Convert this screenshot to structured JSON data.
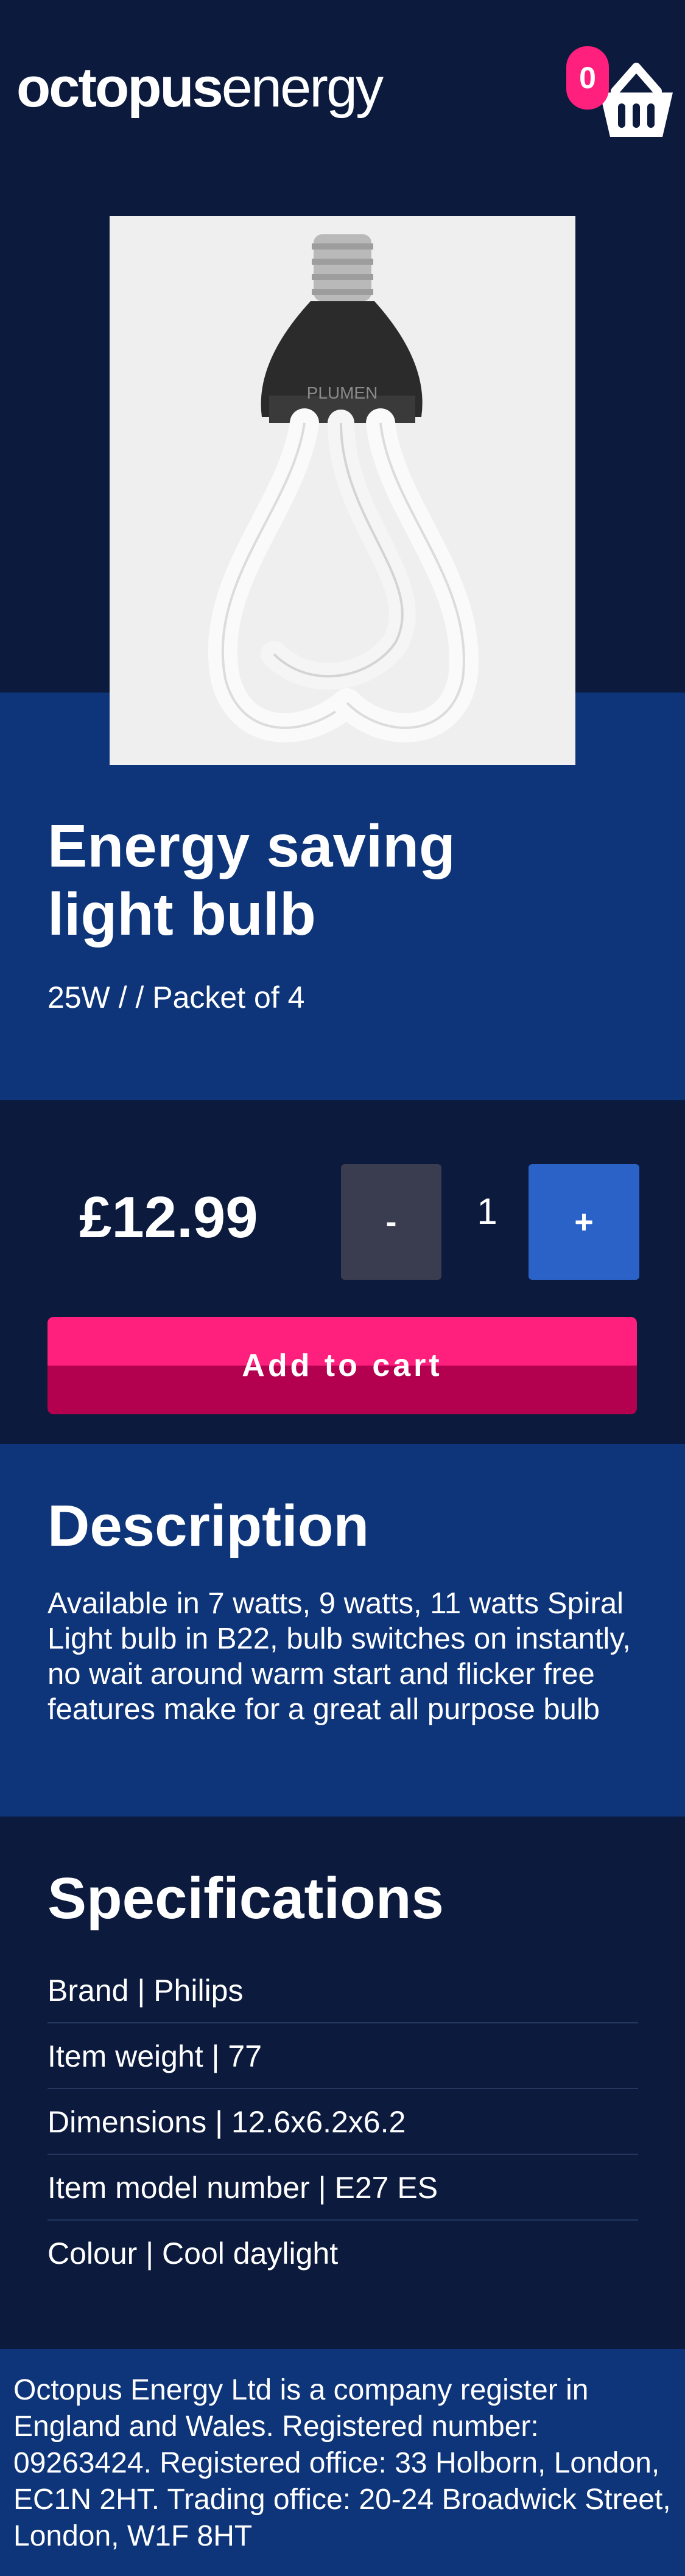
{
  "brand": {
    "logo_bold": "octopus",
    "logo_light": "energy"
  },
  "cart": {
    "count": "0",
    "icon": "basket-icon"
  },
  "product": {
    "image": "light-bulb-image",
    "name": "Energy saving light bulb",
    "variant": "25W / / Packet of 4",
    "price": "£12.99",
    "quantity": "1",
    "minus_label": "-",
    "plus_label": "+",
    "add_to_cart_label": "Add to cart"
  },
  "description": {
    "title": "Description",
    "text": "Available in 7 watts, 9 watts, 11 watts Spiral Light bulb in B22, bulb switches on instantly, no wait around warm start and flicker free features make for a great all purpose bulb"
  },
  "specifications": {
    "title": "Specifications",
    "items": [
      "Brand | Philips",
      "Item weight | 77",
      "Dimensions | 12.6x6.2x6.2",
      "Item model number | E27 ES",
      "Colour | Cool daylight"
    ]
  },
  "footer": {
    "text": "Octopus Energy Ltd is a company register in England and Wales. Registered number: 09263424. Registered office: 33 Holborn, London, EC1N 2HT. Trading office: 20-24 Broadwick Street, London, W1F 8HT"
  },
  "colors": {
    "navy": "#0b1a3d",
    "blue": "#0e3579",
    "pink": "#ff1f7c",
    "button_blue": "#2b62c8",
    "button_grey": "#3a3c4f"
  }
}
